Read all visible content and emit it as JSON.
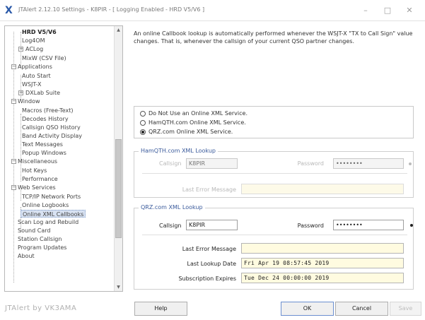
{
  "window": {
    "app_icon": "X",
    "title": "JTAlert 2.12.10 Settings  -  K8PIR  -  [ Logging Enabled - HRD V5/V6 ]",
    "minimize": "–",
    "maximize": "□",
    "close": "✕"
  },
  "tree": {
    "items": [
      {
        "label": "HRD V5/V6"
      },
      {
        "label": "Log4OM"
      },
      {
        "label": "ACLog"
      },
      {
        "label": "MixW (CSV File)"
      },
      {
        "label": "Applications"
      },
      {
        "label": "Auto Start"
      },
      {
        "label": "WSJT-X"
      },
      {
        "label": "DXLab Suite"
      },
      {
        "label": "Window"
      },
      {
        "label": "Macros (Free-Text)"
      },
      {
        "label": "Decodes History"
      },
      {
        "label": "Callsign QSO History"
      },
      {
        "label": "Band Activity Display"
      },
      {
        "label": "Text Messages"
      },
      {
        "label": "Popup Windows"
      },
      {
        "label": "Miscellaneous"
      },
      {
        "label": "Hot Keys"
      },
      {
        "label": "Performance"
      },
      {
        "label": "Web Services"
      },
      {
        "label": "TCP/IP Network Ports"
      },
      {
        "label": "Online Logbooks"
      },
      {
        "label": "Online XML Callbooks"
      },
      {
        "label": "Scan Log and Rebuild"
      },
      {
        "label": "Sound Card"
      },
      {
        "label": "Station Callsign"
      },
      {
        "label": "Program Updates"
      },
      {
        "label": "About"
      }
    ],
    "expander_plus": "+",
    "expander_minus": "−",
    "scroll_up": "▲",
    "scroll_down": "▼"
  },
  "description": "An online Callbook lookup is automatically performed whenever the WSJT-X \"TX to Call Sign\" value changes. That is, whenever the callsign of your current QSO partner changes.",
  "service_options": [
    {
      "label": "Do Not Use an Online XML Service.",
      "selected": false
    },
    {
      "label": "HamQTH.com Online XML Service.",
      "selected": false
    },
    {
      "label": "QRZ.com Online XML Service.",
      "selected": true
    }
  ],
  "hamqth": {
    "title": "HamQTH.com XML Lookup",
    "callsign_label": "Callsign",
    "callsign_value": "K8PIR",
    "password_label": "Password",
    "password_value": "••••••••",
    "last_error_label": "Last Error Message",
    "last_error_value": ""
  },
  "qrz": {
    "title": "QRZ.com XML Lookup",
    "callsign_label": "Callsign",
    "callsign_value": "K8PIR",
    "password_label": "Password",
    "password_value": "••••••••",
    "last_error_label": "Last Error Message",
    "last_error_value": "",
    "last_lookup_label": "Last Lookup Date",
    "last_lookup_value": "Fri Apr 19 08:57:45 2019",
    "subscription_label": "Subscription Expires",
    "subscription_value": "Tue Dec 24 00:00:00 2019"
  },
  "footer": {
    "brand": "JTAlert by VK3AMA",
    "help": "Help",
    "ok": "OK",
    "cancel": "Cancel",
    "save": "Save"
  }
}
